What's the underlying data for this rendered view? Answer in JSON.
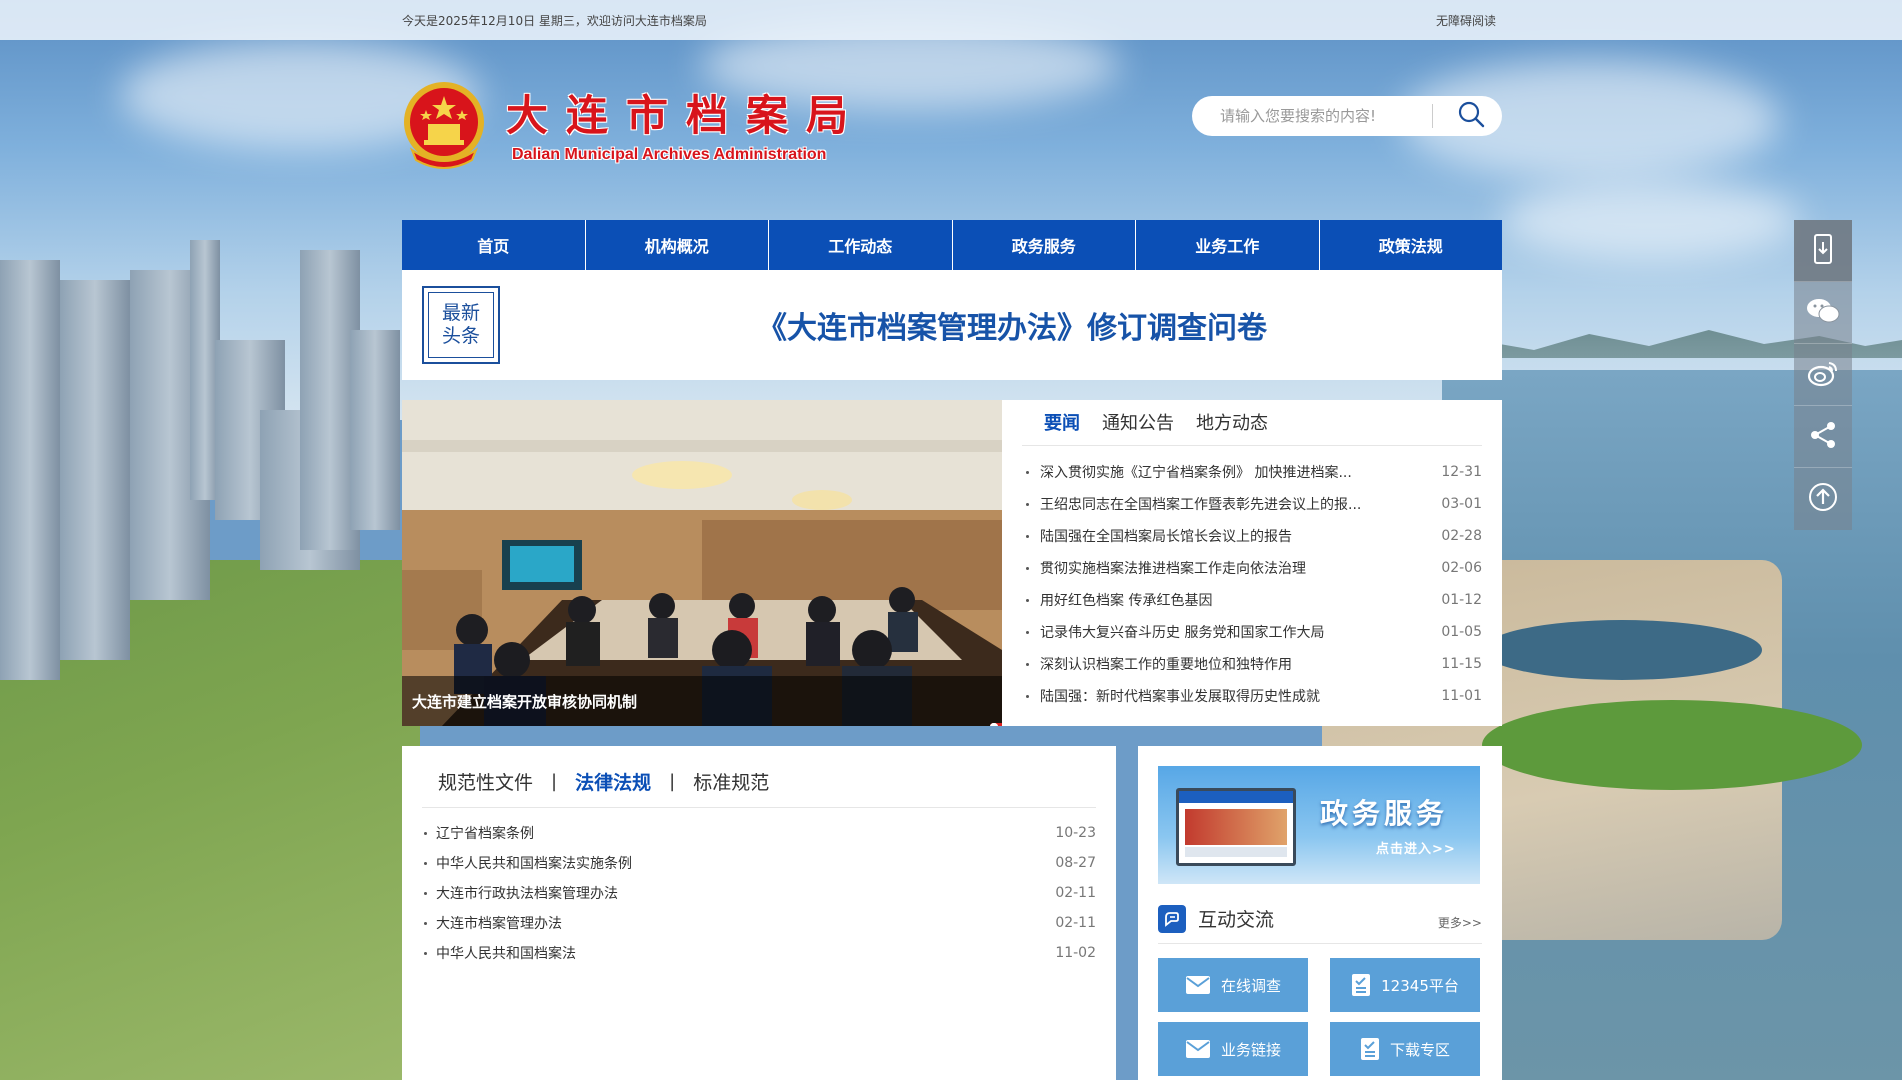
{
  "topbar": {
    "date_text": "今天是2025年12月10日 星期三，欢迎访问大连市档案局",
    "accessibility_label": "无障碍阅读"
  },
  "header": {
    "title": "大连市档案局",
    "subtitle": "Dalian Municipal Archives Administration"
  },
  "search": {
    "placeholder": "请输入您要搜索的内容!",
    "icon": "search-icon"
  },
  "nav": {
    "items": [
      "首页",
      "机构概况",
      "工作动态",
      "政务服务",
      "业务工作",
      "政策法规"
    ]
  },
  "headline": {
    "badge_line1": "最新",
    "badge_line2": "头条",
    "title": "《大连市档案管理办法》修订调查问卷"
  },
  "slider": {
    "caption": "大连市建立档案开放审核协同机制",
    "dots": 4,
    "active_dot": 0
  },
  "news": {
    "tabs": [
      "要闻",
      "通知公告",
      "地方动态"
    ],
    "active_tab": 0,
    "items": [
      {
        "title": "深入贯彻实施《辽宁省档案条例》 加快推进档案...",
        "date": "12-31"
      },
      {
        "title": "王绍忠同志在全国档案工作暨表彰先进会议上的报...",
        "date": "03-01"
      },
      {
        "title": "陆国强在全国档案局长馆长会议上的报告",
        "date": "02-28"
      },
      {
        "title": "贯彻实施档案法推进档案工作走向依法治理",
        "date": "02-06"
      },
      {
        "title": "用好红色档案 传承红色基因",
        "date": "01-12"
      },
      {
        "title": "记录伟大复兴奋斗历史 服务党和国家工作大局",
        "date": "01-05"
      },
      {
        "title": "深刻认识档案工作的重要地位和独特作用",
        "date": "11-15"
      },
      {
        "title": "陆国强：新时代档案事业发展取得历史性成就",
        "date": "11-01"
      }
    ]
  },
  "regulations": {
    "tabs": [
      "规范性文件",
      "法律法规",
      "标准规范"
    ],
    "separator": "|",
    "active_tab": 1,
    "items": [
      {
        "title": "辽宁省档案条例",
        "date": "10-23"
      },
      {
        "title": "中华人民共和国档案法实施条例",
        "date": "08-27"
      },
      {
        "title": "大连市行政执法档案管理办法",
        "date": "02-11"
      },
      {
        "title": "大连市档案管理办法",
        "date": "02-11"
      },
      {
        "title": "中华人民共和国档案法",
        "date": "11-02"
      }
    ]
  },
  "gov_banner": {
    "title": "政务服务",
    "enter": "点击进入>>"
  },
  "interaction": {
    "title": "互动交流",
    "more": "更多>>",
    "buttons": [
      {
        "label": "在线调查",
        "icon": "envelope-icon"
      },
      {
        "label": "12345平台",
        "icon": "document-icon"
      },
      {
        "label": "业务链接",
        "icon": "envelope-icon"
      },
      {
        "label": "下载专区",
        "icon": "document-icon"
      }
    ]
  },
  "side_tools": [
    "mobile-icon",
    "wechat-icon",
    "weibo-icon",
    "share-icon",
    "back-to-top-icon"
  ],
  "colors": {
    "brand_blue": "#0b4fb6",
    "title_red": "#d8141b",
    "button_blue": "#5aa0d8"
  }
}
